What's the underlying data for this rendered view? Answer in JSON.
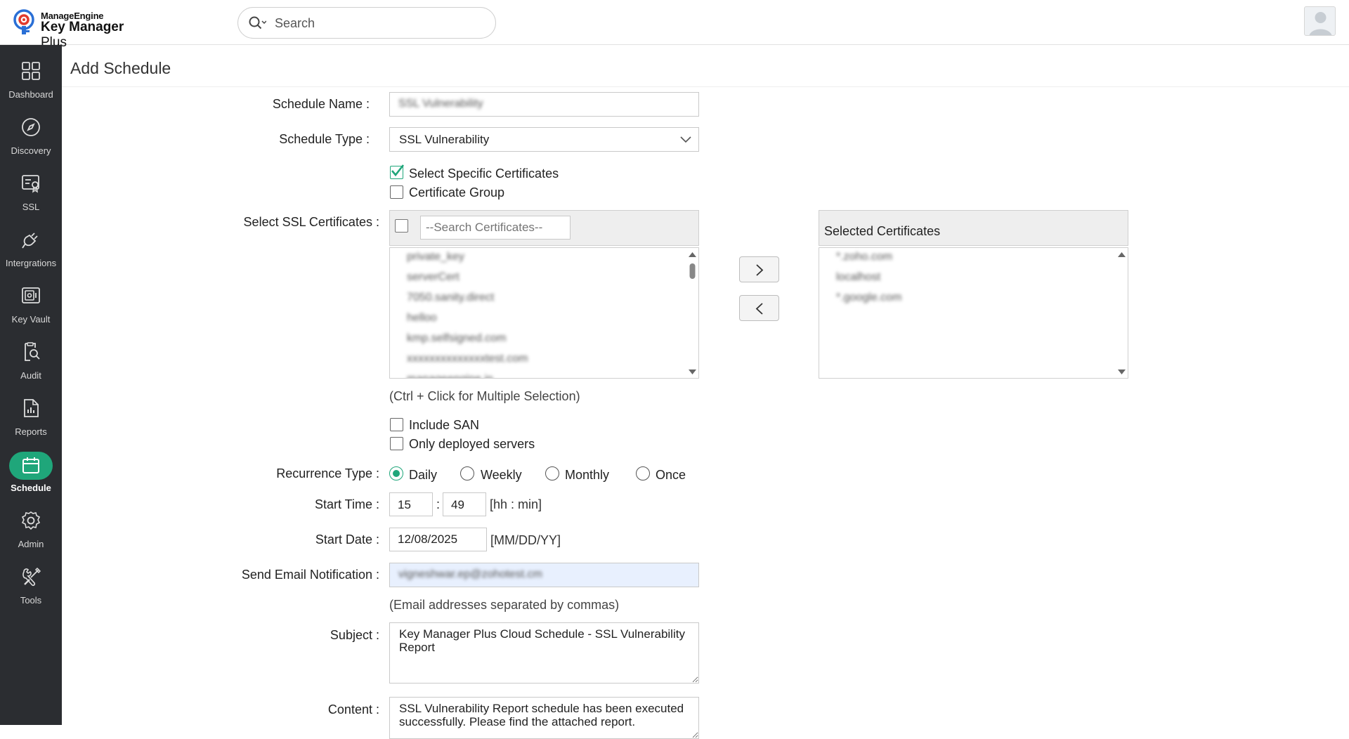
{
  "header": {
    "brand_top": "ManageEngine",
    "brand_name": "Key Manager",
    "brand_suffix": "Plus",
    "search_placeholder": "Search"
  },
  "sidebar": {
    "items": [
      {
        "label": "Dashboard",
        "icon": "dashboard-icon"
      },
      {
        "label": "Discovery",
        "icon": "compass-icon"
      },
      {
        "label": "SSL",
        "icon": "certificate-icon"
      },
      {
        "label": "Intergrations",
        "icon": "plug-icon"
      },
      {
        "label": "Key Vault",
        "icon": "vault-icon"
      },
      {
        "label": "Audit",
        "icon": "audit-search-icon"
      },
      {
        "label": "Reports",
        "icon": "report-chart-icon"
      },
      {
        "label": "Schedule",
        "icon": "calendar-icon",
        "active": true
      },
      {
        "label": "Admin",
        "icon": "gear-icon"
      },
      {
        "label": "Tools",
        "icon": "tools-icon"
      }
    ]
  },
  "page": {
    "title": "Add Schedule"
  },
  "form": {
    "schedule_name_label": "Schedule Name",
    "schedule_name_value": "SSL Vulnerability",
    "schedule_type_label": "Schedule Type",
    "schedule_type_value": "SSL Vulnerability",
    "select_specific_label": "Select Specific Certificates",
    "select_specific_checked": true,
    "certificate_group_label": "Certificate Group",
    "certificate_group_checked": false,
    "select_ssl_label": "Select SSL Certificates",
    "search_certs_placeholder": "--Search Certificates--",
    "available_certs": [
      "private_key",
      "serverCert",
      "7050.sanity.direct",
      "helloo",
      "kmp.selfsigned.com",
      "xxxxxxxxxxxxxxtest.com",
      "manageengine.in"
    ],
    "selected_header": "Selected Certificates",
    "selected_certs": [
      "*.zoho.com",
      "localhost",
      "*.google.com"
    ],
    "multi_select_hint": "(Ctrl + Click for Multiple Selection)",
    "include_san_label": "Include SAN",
    "include_san_checked": false,
    "only_deployed_label": "Only deployed servers",
    "only_deployed_checked": false,
    "recurrence_label": "Recurrence Type",
    "recurrence_options": [
      "Daily",
      "Weekly",
      "Monthly",
      "Once"
    ],
    "recurrence_selected": "Daily",
    "start_time_label": "Start Time",
    "start_hour": "15",
    "time_separator": ":",
    "start_min": "49",
    "time_format_hint": "[hh : min]",
    "start_date_label": "Start Date",
    "start_date_value": "12/08/2025",
    "date_format_hint": "[MM/DD/YY]",
    "email_label": "Send Email Notification",
    "email_value": "vigneshwar.ep@zohotest.cm",
    "email_hint": "(Email addresses separated by commas)",
    "subject_label": "Subject",
    "subject_value": "Key Manager Plus Cloud Schedule - SSL Vulnerability Report",
    "content_label": "Content",
    "content_value": "SSL Vulnerability Report schedule has been executed successfully. Please find the attached report.",
    "colon": ":"
  },
  "colors": {
    "accent": "#1fa67a",
    "sidebar_bg": "#2b2d31"
  }
}
